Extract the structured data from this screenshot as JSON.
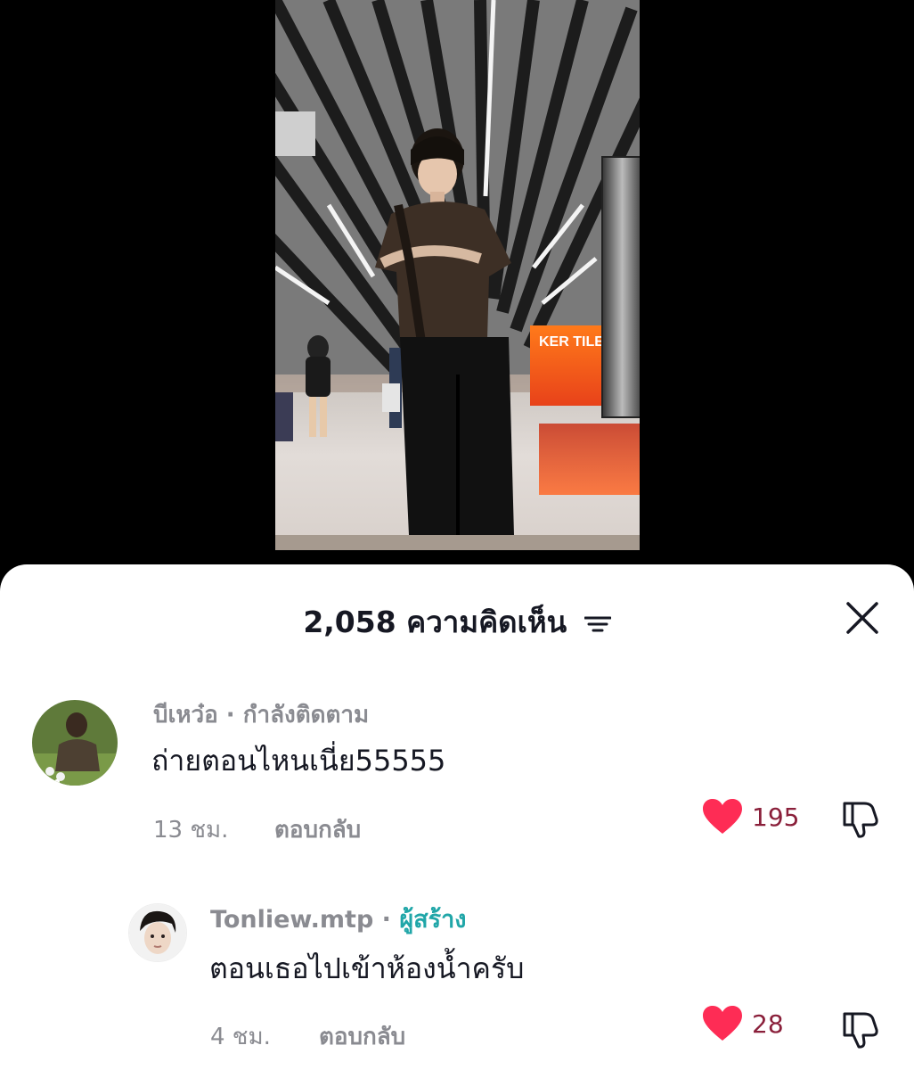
{
  "video": {
    "sign_text": "KER TILES"
  },
  "comments_panel": {
    "title": "2,058 ความคิดเห็น",
    "filter_icon": "sort-lines-icon",
    "close_icon": "close-icon"
  },
  "comments": [
    {
      "username": "บีเหว๋อ",
      "meta": " · กำลังติดตาม",
      "text": "ถ่ายตอนไหนเนี่ย55555",
      "time": "13 ชม.",
      "reply_label": "ตอบกลับ",
      "likes": "195"
    },
    {
      "username": "Tonliew.mtp",
      "separator": " · ",
      "badge": "ผู้สร้าง",
      "text": "ตอนเธอไปเข้าห้องน้ำครับ",
      "time": "4 ชม.",
      "reply_label": "ตอบกลับ",
      "likes": "28"
    }
  ],
  "colors": {
    "like_heart": "#fe2c55",
    "creator_badge": "#20a6a8",
    "muted_text": "#8a8b91"
  }
}
